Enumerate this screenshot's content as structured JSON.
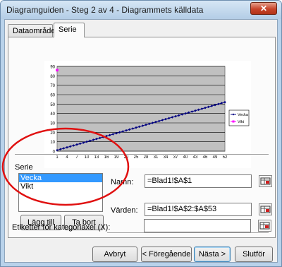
{
  "window": {
    "title": "Diagramguiden - Steg 2 av 4 - Diagrammets källdata",
    "close_glyph": "✕"
  },
  "tabs": [
    {
      "label": "Dataområde",
      "active": false
    },
    {
      "label": "Serie",
      "active": true
    }
  ],
  "chart_data": {
    "type": "line",
    "x_tick_labels": [
      "1",
      "4",
      "7",
      "10",
      "13",
      "16",
      "19",
      "22",
      "25",
      "28",
      "31",
      "34",
      "37",
      "40",
      "43",
      "46",
      "49",
      "52"
    ],
    "y_tick_labels": [
      "0",
      "10",
      "20",
      "30",
      "40",
      "50",
      "60",
      "70",
      "80",
      "90"
    ],
    "ylim": [
      0,
      90
    ],
    "grid": true,
    "legend_position": "right",
    "series": [
      {
        "name": "Vecka",
        "color": "#000080",
        "marker": "diamond",
        "x_start": 1,
        "x_end": 52,
        "y_start": 1,
        "y_end": 52,
        "kind": "linear"
      },
      {
        "name": "Vikt",
        "color": "#ff00ff",
        "marker": "square",
        "points": [
          [
            1,
            86
          ]
        ]
      }
    ]
  },
  "series_section": {
    "heading": "Serie",
    "items": [
      "Vecka",
      "Vikt"
    ],
    "selected_index": 0,
    "add_button": "Lägg till",
    "remove_button": "Ta bort",
    "name_label": "Namn:",
    "name_value": "=Blad1!$A$1",
    "values_label": "Värden:",
    "values_value": "=Blad1!$A$2:$A$53",
    "category_label": "Etiketter för kategoriaxel (X):",
    "category_value": ""
  },
  "footer": {
    "cancel": "Avbryt",
    "back": "< Föregående",
    "next": "Nästa >",
    "finish": "Slutför"
  },
  "colors": {
    "annotation_circle": "#e01010",
    "plot_area": "#c0c0c0",
    "selection": "#3399ff"
  }
}
